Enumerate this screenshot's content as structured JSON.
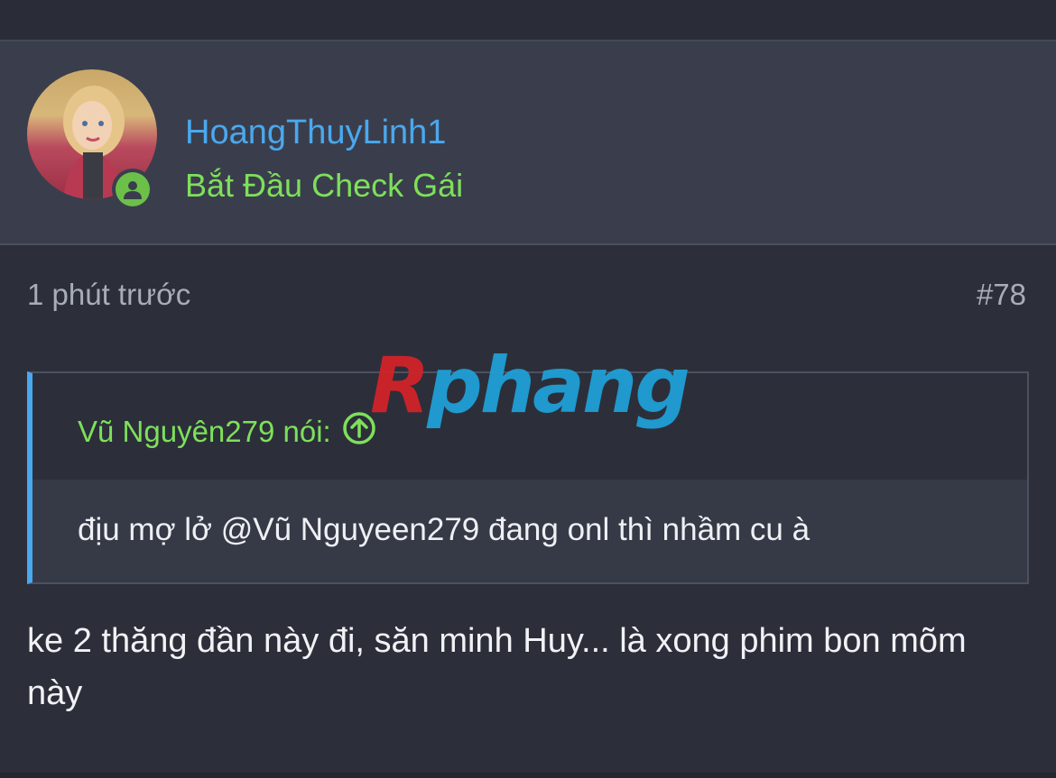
{
  "post": {
    "username": "HoangThuyLinh1",
    "user_title": "Bắt Đầu Check Gái",
    "time": "1 phút trước",
    "number": "#78",
    "quote": {
      "author_label": "Vũ Nguyên279 nói:",
      "text": "địu mợ lở @Vũ Nguyeen279 đang onl thì nhầm cu à"
    },
    "message": "ke 2 thăng đần này đi, săn minh Huy... là xong phim bon mõm này"
  },
  "watermark": {
    "first_letter": "R",
    "rest": "phang"
  },
  "icons": {
    "status": "user-online-icon",
    "jump": "arrow-up-circle-icon"
  },
  "colors": {
    "username": "#4aa8ee",
    "user_title": "#7ee05a",
    "quote_accent": "#4aa8ee",
    "online_status": "#6cc04a"
  }
}
